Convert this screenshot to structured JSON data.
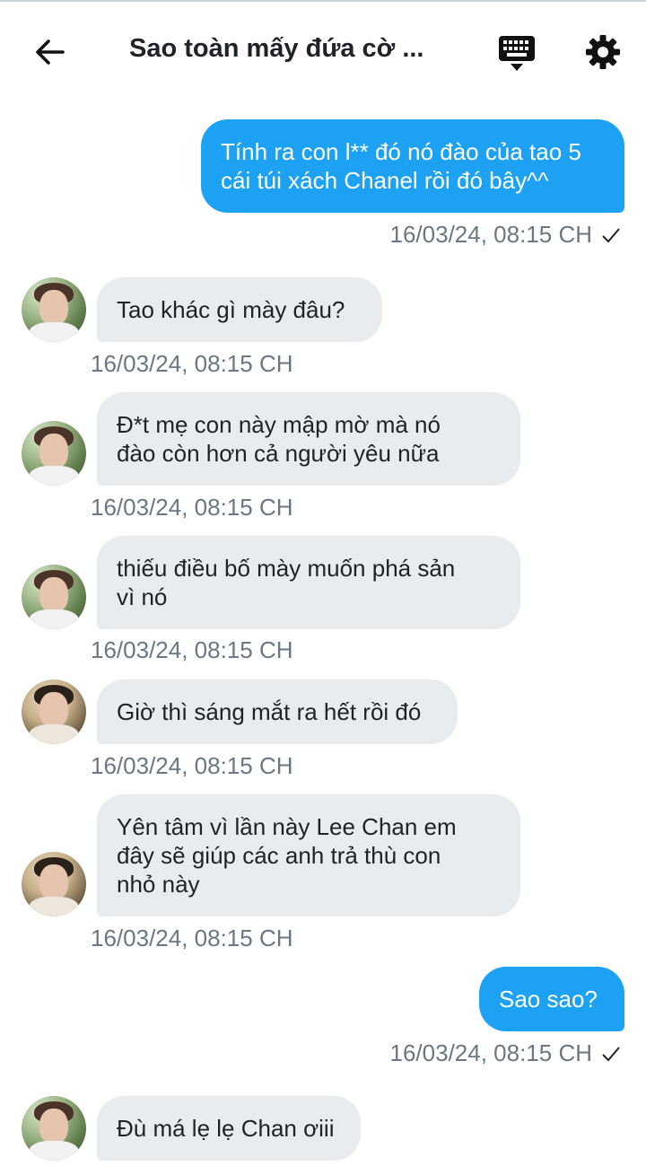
{
  "header": {
    "title": "Sao toàn mấy đứa cờ ...",
    "back_icon": "arrow-left-icon",
    "keyboard_icon": "keyboard-icon",
    "settings_icon": "gear-icon"
  },
  "colors": {
    "outgoing_bubble": "#1da1f2",
    "incoming_bubble": "#e8ecef",
    "timestamp": "#6b7782"
  },
  "messages": [
    {
      "direction": "out",
      "text_lines": [
        "Tính ra con l** đó nó đào của tao 5",
        "cái túi xách Chanel rồi đó bây^^"
      ],
      "time": "16/03/24, 08:15 CH",
      "read_icon": "check-icon"
    },
    {
      "direction": "in",
      "text_lines": [
        "Tao khác gì mày đâu?"
      ],
      "time": "16/03/24, 08:15 CH"
    },
    {
      "direction": "in",
      "text_lines": [
        "Đ*t mẹ con này mập mờ mà nó",
        "đào còn hơn cả người yêu nữa"
      ],
      "time": "16/03/24, 08:15 CH"
    },
    {
      "direction": "in",
      "text_lines": [
        "thiếu điều bố mày muốn phá sản",
        "vì nó"
      ],
      "time": "16/03/24, 08:15 CH"
    },
    {
      "direction": "in",
      "text_lines": [
        "Giờ thì sáng mắt ra hết rồi đó"
      ],
      "time": "16/03/24, 08:15 CH"
    },
    {
      "direction": "in",
      "text_lines": [
        "Yên tâm vì lần này Lee Chan em",
        "đây sẽ giúp các anh trả thù con",
        "nhỏ này"
      ],
      "time": "16/03/24, 08:15 CH"
    },
    {
      "direction": "out",
      "text_lines": [
        "Sao sao?"
      ],
      "time": "16/03/24, 08:15 CH",
      "read_icon": "check-icon"
    },
    {
      "direction": "in",
      "text_lines": [
        "Đù má lẹ lẹ Chan ơiii"
      ],
      "time": ""
    }
  ]
}
